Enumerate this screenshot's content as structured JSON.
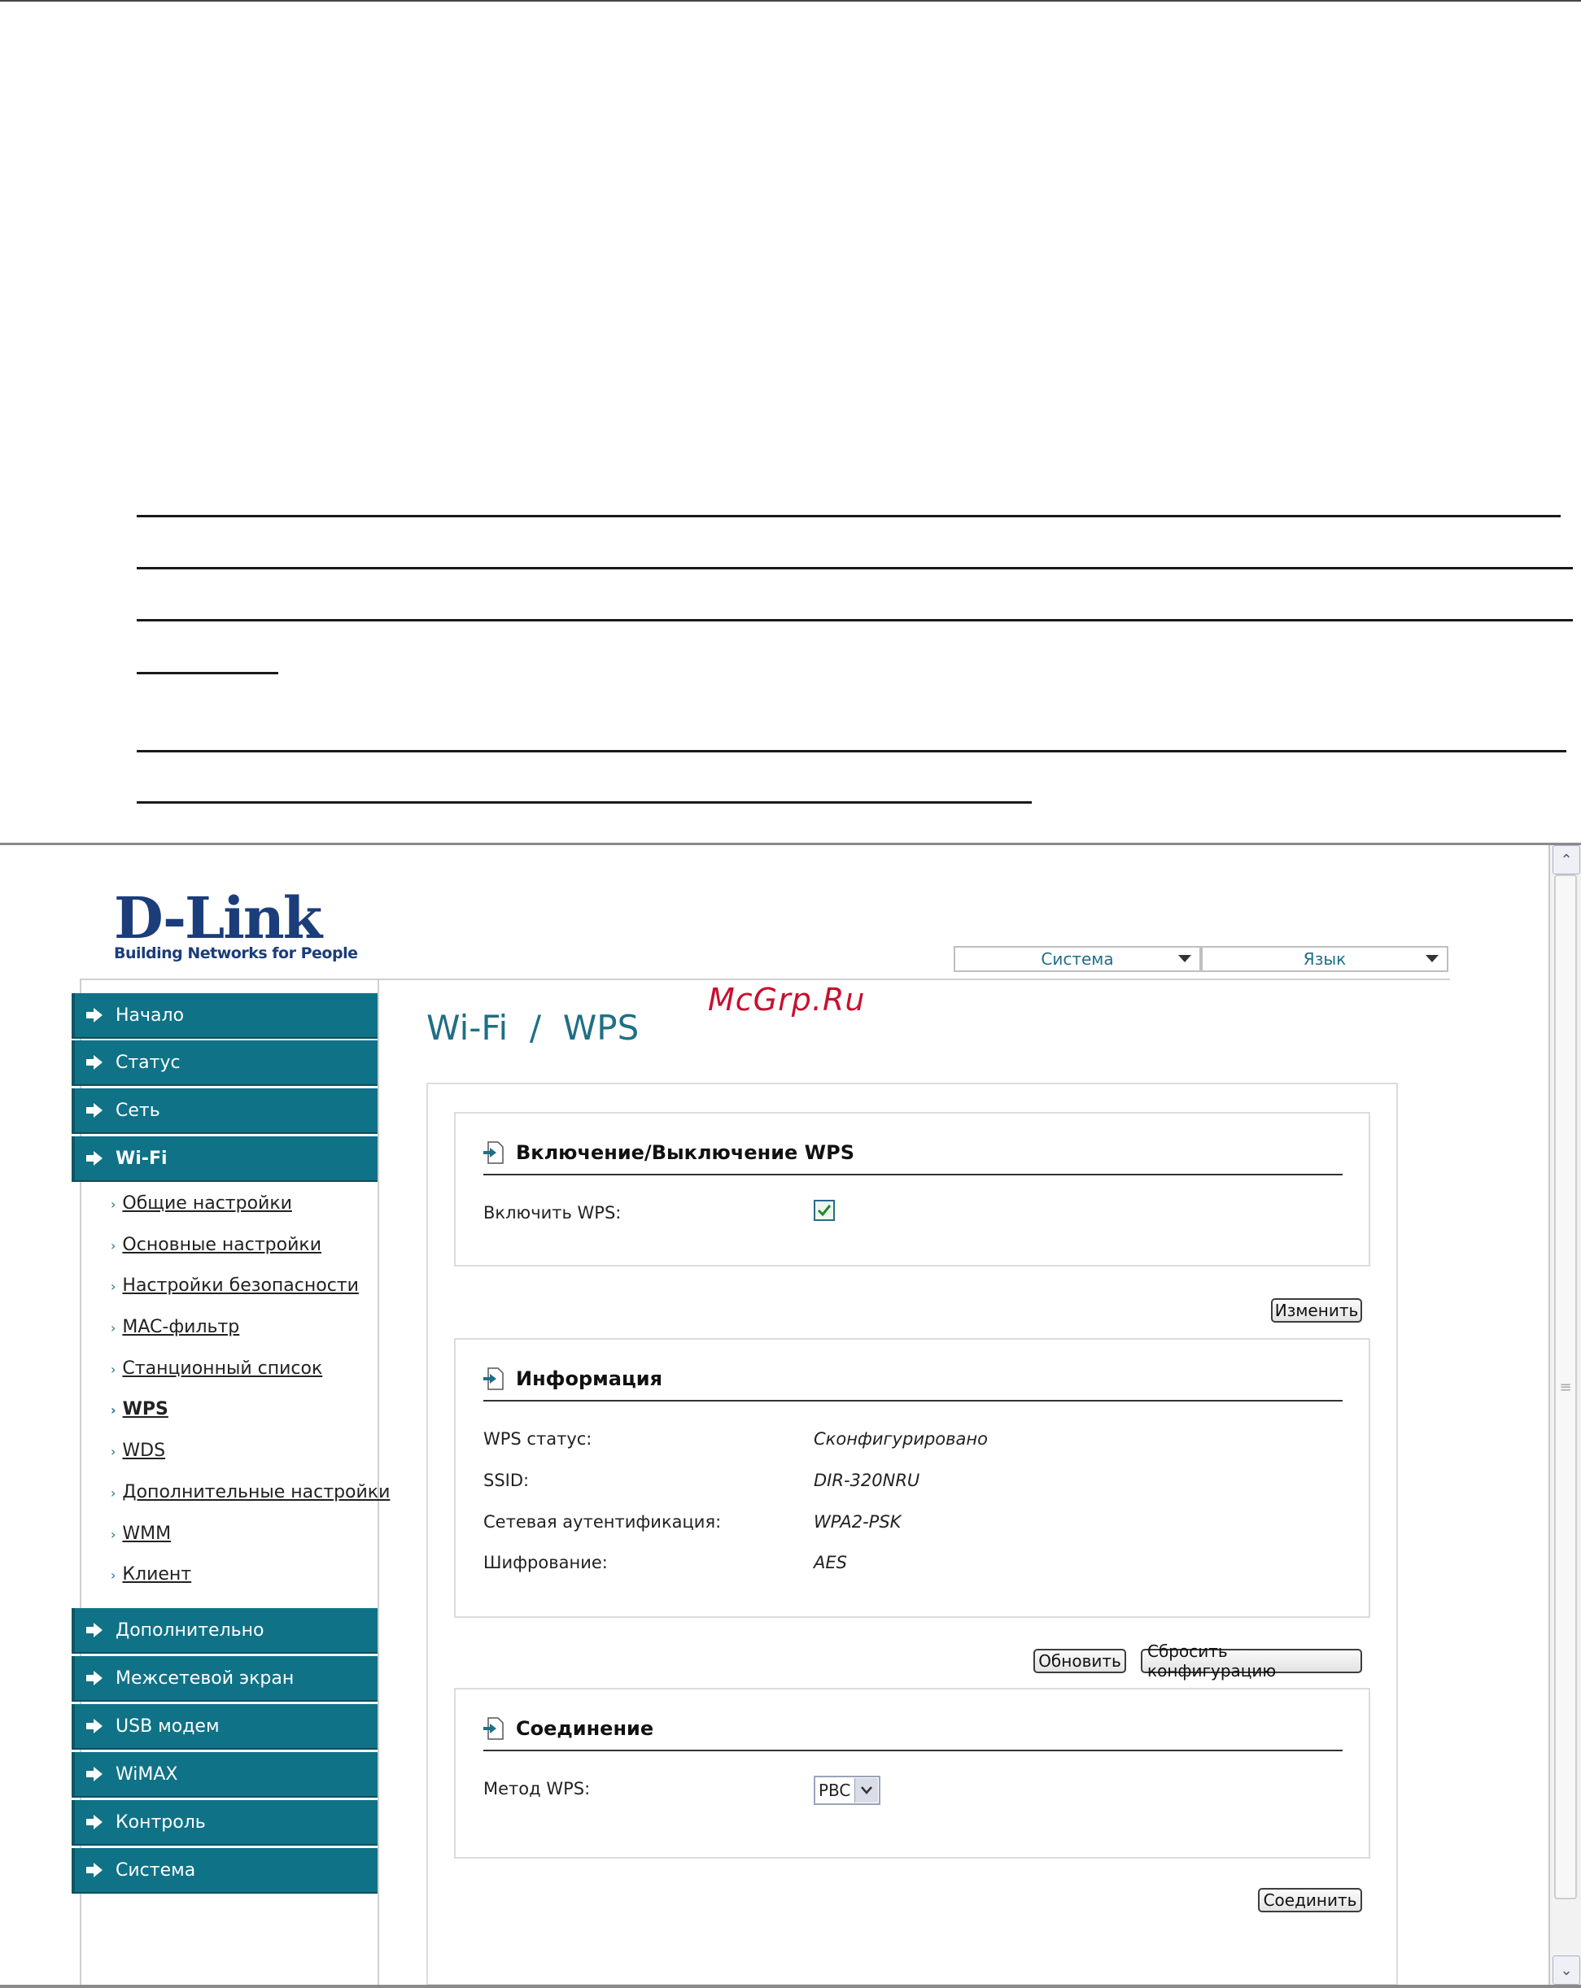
{
  "watermark": "McGrp.Ru",
  "logo": {
    "brand": "D-Link",
    "tagline": "Building Networks for People"
  },
  "top_menus": [
    {
      "label": "Система"
    },
    {
      "label": "Язык"
    }
  ],
  "nav": {
    "main_top": [
      {
        "label": "Начало"
      },
      {
        "label": "Статус"
      },
      {
        "label": "Сеть"
      },
      {
        "label": "Wi-Fi"
      }
    ],
    "wifi_sub": [
      {
        "label": "Общие настройки"
      },
      {
        "label": "Основные настройки"
      },
      {
        "label": "Настройки безопасности"
      },
      {
        "label": "MAC-фильтр"
      },
      {
        "label": "Станционный список"
      },
      {
        "label": "WPS"
      },
      {
        "label": "WDS"
      },
      {
        "label": "Дополнительные настройки"
      },
      {
        "label": "WMM"
      },
      {
        "label": "Клиент"
      }
    ],
    "main_bottom": [
      {
        "label": "Дополнительно"
      },
      {
        "label": "Межсетевой экран"
      },
      {
        "label": "USB модем"
      },
      {
        "label": "WiMAX"
      },
      {
        "label": "Контроль"
      },
      {
        "label": "Система"
      }
    ]
  },
  "page": {
    "title": "Wi-Fi  /  WPS"
  },
  "wps_toggle": {
    "title": "Включение/Выключение WPS",
    "enable_label": "Включить WPS:",
    "enabled": true,
    "apply_button": "Изменить"
  },
  "info": {
    "title": "Информация",
    "rows": [
      {
        "label": "WPS статус:",
        "value": "Сконфигурировано"
      },
      {
        "label": "SSID:",
        "value": "DIR-320NRU"
      },
      {
        "label": "Сетевая аутентификация:",
        "value": "WPA2-PSK"
      },
      {
        "label": "Шифрование:",
        "value": "AES"
      }
    ],
    "refresh_button": "Обновить",
    "reset_button": "Сбросить конфигурацию"
  },
  "connection": {
    "title": "Соединение",
    "method_label": "Метод WPS:",
    "method_value": "PBC",
    "connect_button": "Соединить"
  },
  "colors": {
    "nav_bg": "#0f7287",
    "accent_text": "#1f6f86",
    "watermark": "#c8102e"
  }
}
